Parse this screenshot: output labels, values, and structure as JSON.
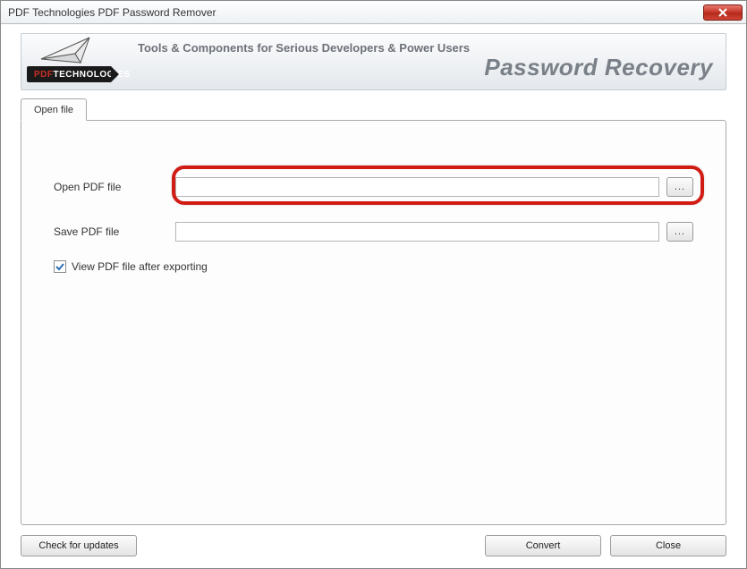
{
  "window": {
    "title": "PDF Technologies PDF Password Remover"
  },
  "banner": {
    "tagline": "Tools & Components for Serious Developers & Power Users",
    "heading": "Password Recovery",
    "logo_pdf": "PDF",
    "logo_tech": "TECHNOLOGIES"
  },
  "tabs": {
    "open_file": "Open file"
  },
  "form": {
    "open_label": "Open PDF file",
    "open_value": "",
    "save_label": "Save PDF file",
    "save_value": "",
    "browse_label": "...",
    "view_after_label": "View PDF file after exporting",
    "view_after_checked": true
  },
  "footer": {
    "check_updates": "Check for updates",
    "convert": "Convert",
    "close": "Close"
  }
}
